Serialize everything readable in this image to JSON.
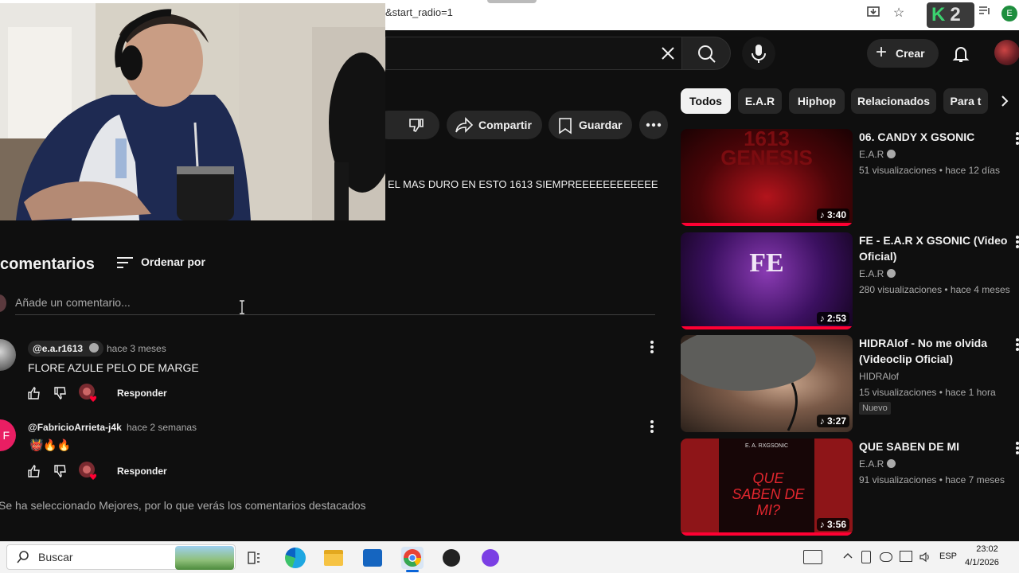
{
  "browser": {
    "url": "&start_radio=1",
    "extension_count": "2",
    "profile_initial": "E"
  },
  "header": {
    "create_label": "Crear"
  },
  "chips": [
    "Todos",
    "E.A.R",
    "Hiphop",
    "Relacionados",
    "Para t"
  ],
  "actions": {
    "share_label": "Compartir",
    "save_label": "Guardar"
  },
  "description": {
    "text": "EL MAS DURO EN ESTO 1613 SIEMPREEEEEEEEEEEE"
  },
  "comments": {
    "title": "comentarios",
    "sort_label": "Ordenar por",
    "add_placeholder": "Añade un comentario...",
    "items": [
      {
        "author": "@e.a.r1613",
        "verified": true,
        "time": "hace 3 meses",
        "text": "FLORE AZULE PELO DE MARGE",
        "reply_label": "Responder"
      },
      {
        "author": "@FabricioArrieta-j4k",
        "time": "hace 2 semanas",
        "text": "👹🔥🔥",
        "reply_label": "Responder",
        "avatar_letter": "F"
      }
    ],
    "footer_note": "Se ha seleccionado Mejores, por lo que verás los comentarios destacados"
  },
  "related": [
    {
      "title": "06. CANDY X GSONIC",
      "channel": "E.A.R",
      "verified": true,
      "meta": "51 visualizaciones • hace 12 días",
      "duration": "3:40",
      "thumb_text": "1613 GENESIS"
    },
    {
      "title": "FE - E.A.R X GSONIC (Video Oficial)",
      "channel": "E.A.R",
      "verified": true,
      "meta": "280 visualizaciones • hace 4 meses",
      "duration": "2:53",
      "thumb_text": "FE"
    },
    {
      "title": "HIDRAlof - No me olvida (Videoclip Oficial)",
      "channel": "HIDRAlof",
      "meta": "15 visualizaciones • hace 1 hora",
      "badge": "Nuevo",
      "duration": "3:27"
    },
    {
      "title": "QUE SABEN DE MI",
      "channel": "E.A.R",
      "verified": true,
      "meta": "91 visualizaciones • hace 7 meses",
      "duration": "3:56",
      "thumb_text": "QUE SABEN DE MI?",
      "thumb_top_text": "E. A. RXGSONIC"
    }
  ],
  "taskbar": {
    "search_label": "Buscar",
    "language": "ESP",
    "time": "23:02",
    "date": "4/1/2026"
  },
  "colors": {
    "accent_red": "#ff0033",
    "bg": "#0f0f0f",
    "chip_bg": "#272727"
  }
}
